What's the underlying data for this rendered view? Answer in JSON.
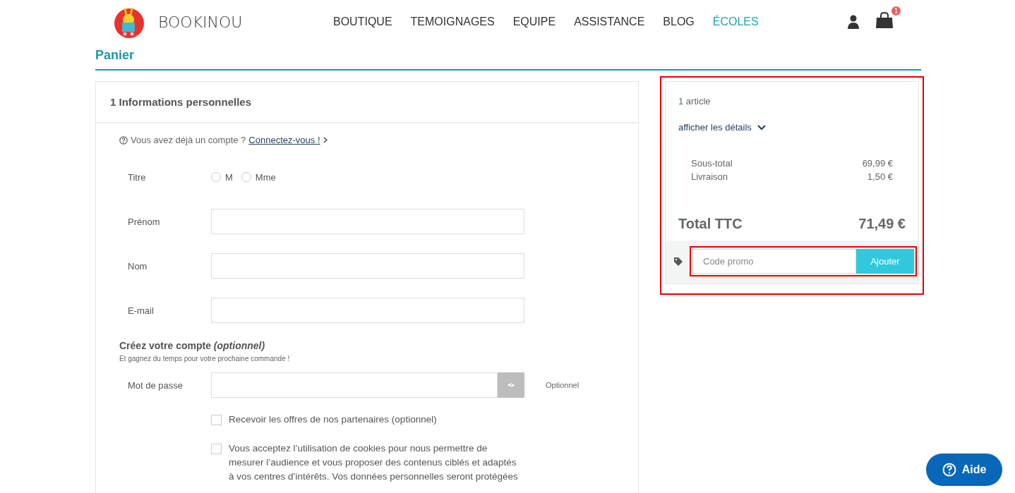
{
  "header": {
    "brand": "BOOKINOU",
    "nav": [
      {
        "label": "BOUTIQUE",
        "selected": false
      },
      {
        "label": "TEMOIGNAGES",
        "selected": false
      },
      {
        "label": "EQUIPE",
        "selected": false
      },
      {
        "label": "ASSISTANCE",
        "selected": false
      },
      {
        "label": "BLOG",
        "selected": false
      },
      {
        "label": "ÉCOLES",
        "selected": true
      }
    ],
    "cart_count": "1"
  },
  "page_title": "Panier",
  "form": {
    "title": "1 Informations personnelles",
    "login_prompt": "Vous avez déjà un compte ?",
    "login_link": "Connectez-vous !",
    "title_label": "Titre",
    "title_options": [
      {
        "label": "M",
        "selected": false
      },
      {
        "label": "Mme",
        "selected": false
      }
    ],
    "fields": [
      {
        "label": "Prénom"
      },
      {
        "label": "Nom"
      },
      {
        "label": "E-mail"
      }
    ],
    "account_heading": "Créez votre compte *(optionnel)*",
    "account_subtitle": "Et gagnez du temps pour votre prochaine commande !",
    "password_label": "Mot de passe",
    "password_note": "Optionnel",
    "checkboxes": [
      {
        "label": "Recevoir les offres de nos partenaires (optionnel)",
        "checked": false
      },
      {
        "label": "Vous acceptez l’utilisation de cookies pour nous permettre de mesurer l’audience et vous proposer des contenus ciblés et adaptés à vos centres d’intérêts. Vos données personnelles seront protégées",
        "checked": false
      }
    ]
  },
  "summary": {
    "highlighted": true,
    "count": "1 article",
    "details_link": "afficher les détails",
    "lines": [
      {
        "label": "Sous-total",
        "value": "69,99 €"
      },
      {
        "label": "Livraison",
        "value": "1,50 €"
      }
    ],
    "total_label": "Total TTC",
    "total_value": "71,49 €",
    "promo": {
      "highlighted": true,
      "placeholder": "Code promo",
      "button": "Ajouter"
    }
  },
  "help_button": "Aide"
}
